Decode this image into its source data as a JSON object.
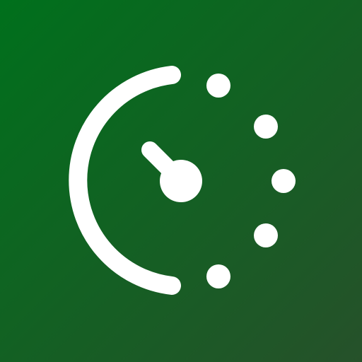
{
  "icon": {
    "name": "timer-icon",
    "colors": {
      "background_start": "#00701c",
      "background_end": "#26512a",
      "foreground": "#ffffff"
    }
  }
}
